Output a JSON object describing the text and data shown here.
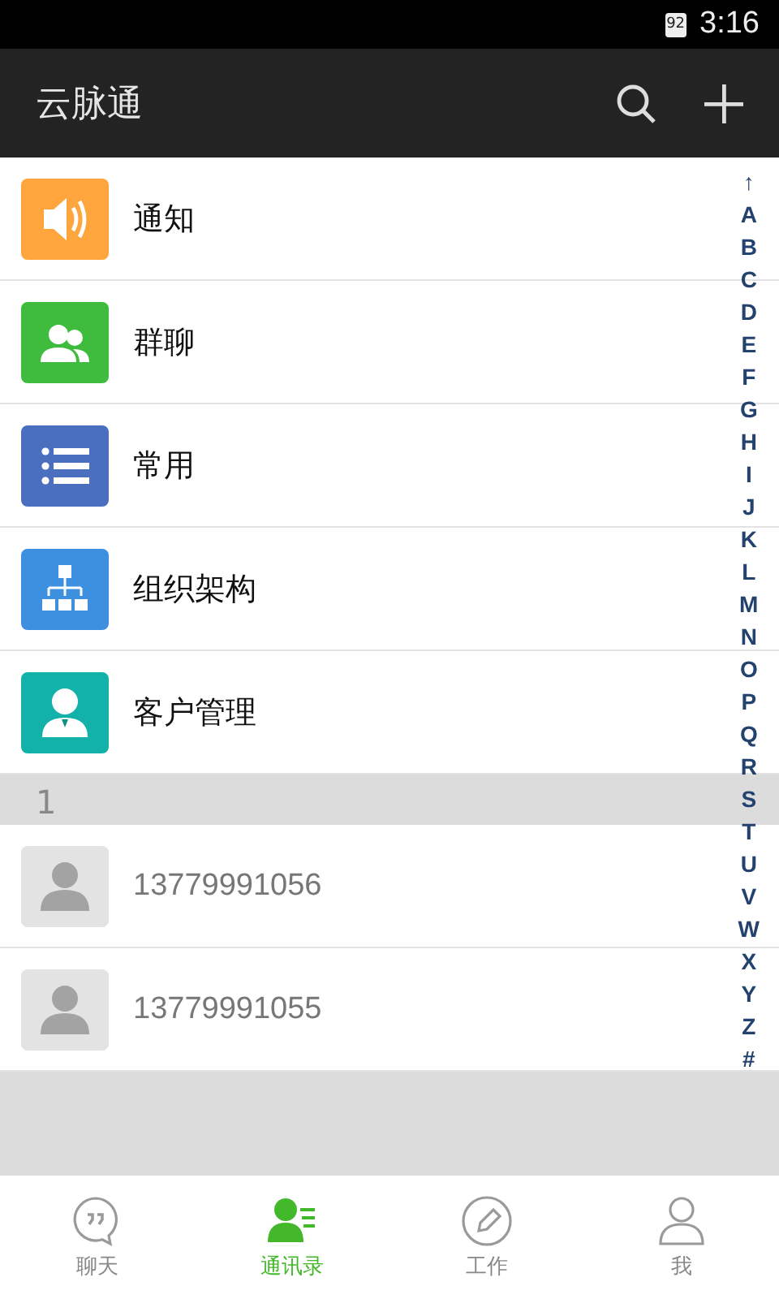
{
  "status_bar": {
    "battery": "92",
    "time": "3:16"
  },
  "app_bar": {
    "title": "云脉通"
  },
  "entries": [
    {
      "kind": "speaker",
      "label": "通知",
      "color": "#ffa53d"
    },
    {
      "kind": "people",
      "label": "群聊",
      "color": "#3fbb3d"
    },
    {
      "kind": "list",
      "label": "常用",
      "color": "#4a6fbf"
    },
    {
      "kind": "org",
      "label": "组织架构",
      "color": "#3d8fe0"
    },
    {
      "kind": "customer",
      "label": "客户管理",
      "color": "#13b2a8"
    }
  ],
  "sections": [
    {
      "header": "1",
      "contacts": [
        {
          "name": "13779991056"
        },
        {
          "name": "13779991055"
        }
      ]
    }
  ],
  "index": [
    "↑",
    "A",
    "B",
    "C",
    "D",
    "E",
    "F",
    "G",
    "H",
    "I",
    "J",
    "K",
    "L",
    "M",
    "N",
    "O",
    "P",
    "Q",
    "R",
    "S",
    "T",
    "U",
    "V",
    "W",
    "X",
    "Y",
    "Z",
    "#"
  ],
  "tabs": [
    {
      "kind": "chat",
      "label": "聊天",
      "selected": false
    },
    {
      "kind": "contacts",
      "label": "通讯录",
      "selected": true
    },
    {
      "kind": "work",
      "label": "工作",
      "selected": false
    },
    {
      "kind": "me",
      "label": "我",
      "selected": false
    }
  ]
}
